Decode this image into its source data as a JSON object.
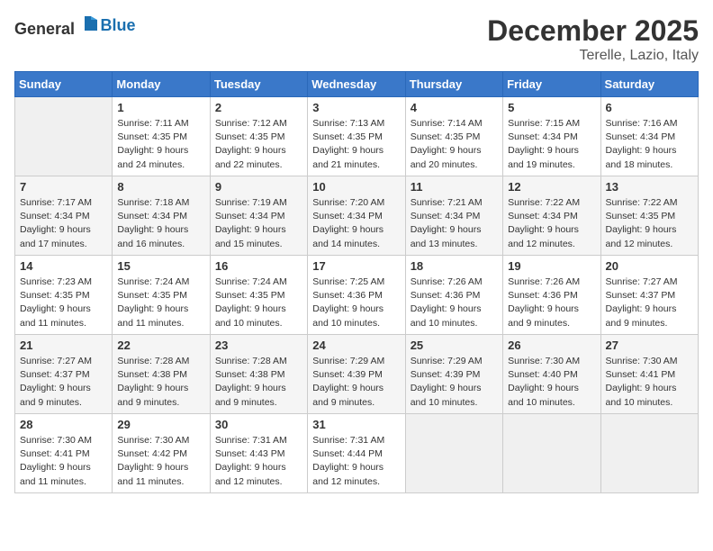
{
  "logo": {
    "general": "General",
    "blue": "Blue"
  },
  "header": {
    "month": "December 2025",
    "location": "Terelle, Lazio, Italy"
  },
  "weekdays": [
    "Sunday",
    "Monday",
    "Tuesday",
    "Wednesday",
    "Thursday",
    "Friday",
    "Saturday"
  ],
  "weeks": [
    [
      {
        "day": "",
        "sunrise": "",
        "sunset": "",
        "daylight": ""
      },
      {
        "day": "1",
        "sunrise": "Sunrise: 7:11 AM",
        "sunset": "Sunset: 4:35 PM",
        "daylight": "Daylight: 9 hours and 24 minutes."
      },
      {
        "day": "2",
        "sunrise": "Sunrise: 7:12 AM",
        "sunset": "Sunset: 4:35 PM",
        "daylight": "Daylight: 9 hours and 22 minutes."
      },
      {
        "day": "3",
        "sunrise": "Sunrise: 7:13 AM",
        "sunset": "Sunset: 4:35 PM",
        "daylight": "Daylight: 9 hours and 21 minutes."
      },
      {
        "day": "4",
        "sunrise": "Sunrise: 7:14 AM",
        "sunset": "Sunset: 4:35 PM",
        "daylight": "Daylight: 9 hours and 20 minutes."
      },
      {
        "day": "5",
        "sunrise": "Sunrise: 7:15 AM",
        "sunset": "Sunset: 4:34 PM",
        "daylight": "Daylight: 9 hours and 19 minutes."
      },
      {
        "day": "6",
        "sunrise": "Sunrise: 7:16 AM",
        "sunset": "Sunset: 4:34 PM",
        "daylight": "Daylight: 9 hours and 18 minutes."
      }
    ],
    [
      {
        "day": "7",
        "sunrise": "Sunrise: 7:17 AM",
        "sunset": "Sunset: 4:34 PM",
        "daylight": "Daylight: 9 hours and 17 minutes."
      },
      {
        "day": "8",
        "sunrise": "Sunrise: 7:18 AM",
        "sunset": "Sunset: 4:34 PM",
        "daylight": "Daylight: 9 hours and 16 minutes."
      },
      {
        "day": "9",
        "sunrise": "Sunrise: 7:19 AM",
        "sunset": "Sunset: 4:34 PM",
        "daylight": "Daylight: 9 hours and 15 minutes."
      },
      {
        "day": "10",
        "sunrise": "Sunrise: 7:20 AM",
        "sunset": "Sunset: 4:34 PM",
        "daylight": "Daylight: 9 hours and 14 minutes."
      },
      {
        "day": "11",
        "sunrise": "Sunrise: 7:21 AM",
        "sunset": "Sunset: 4:34 PM",
        "daylight": "Daylight: 9 hours and 13 minutes."
      },
      {
        "day": "12",
        "sunrise": "Sunrise: 7:22 AM",
        "sunset": "Sunset: 4:34 PM",
        "daylight": "Daylight: 9 hours and 12 minutes."
      },
      {
        "day": "13",
        "sunrise": "Sunrise: 7:22 AM",
        "sunset": "Sunset: 4:35 PM",
        "daylight": "Daylight: 9 hours and 12 minutes."
      }
    ],
    [
      {
        "day": "14",
        "sunrise": "Sunrise: 7:23 AM",
        "sunset": "Sunset: 4:35 PM",
        "daylight": "Daylight: 9 hours and 11 minutes."
      },
      {
        "day": "15",
        "sunrise": "Sunrise: 7:24 AM",
        "sunset": "Sunset: 4:35 PM",
        "daylight": "Daylight: 9 hours and 11 minutes."
      },
      {
        "day": "16",
        "sunrise": "Sunrise: 7:24 AM",
        "sunset": "Sunset: 4:35 PM",
        "daylight": "Daylight: 9 hours and 10 minutes."
      },
      {
        "day": "17",
        "sunrise": "Sunrise: 7:25 AM",
        "sunset": "Sunset: 4:36 PM",
        "daylight": "Daylight: 9 hours and 10 minutes."
      },
      {
        "day": "18",
        "sunrise": "Sunrise: 7:26 AM",
        "sunset": "Sunset: 4:36 PM",
        "daylight": "Daylight: 9 hours and 10 minutes."
      },
      {
        "day": "19",
        "sunrise": "Sunrise: 7:26 AM",
        "sunset": "Sunset: 4:36 PM",
        "daylight": "Daylight: 9 hours and 9 minutes."
      },
      {
        "day": "20",
        "sunrise": "Sunrise: 7:27 AM",
        "sunset": "Sunset: 4:37 PM",
        "daylight": "Daylight: 9 hours and 9 minutes."
      }
    ],
    [
      {
        "day": "21",
        "sunrise": "Sunrise: 7:27 AM",
        "sunset": "Sunset: 4:37 PM",
        "daylight": "Daylight: 9 hours and 9 minutes."
      },
      {
        "day": "22",
        "sunrise": "Sunrise: 7:28 AM",
        "sunset": "Sunset: 4:38 PM",
        "daylight": "Daylight: 9 hours and 9 minutes."
      },
      {
        "day": "23",
        "sunrise": "Sunrise: 7:28 AM",
        "sunset": "Sunset: 4:38 PM",
        "daylight": "Daylight: 9 hours and 9 minutes."
      },
      {
        "day": "24",
        "sunrise": "Sunrise: 7:29 AM",
        "sunset": "Sunset: 4:39 PM",
        "daylight": "Daylight: 9 hours and 9 minutes."
      },
      {
        "day": "25",
        "sunrise": "Sunrise: 7:29 AM",
        "sunset": "Sunset: 4:39 PM",
        "daylight": "Daylight: 9 hours and 10 minutes."
      },
      {
        "day": "26",
        "sunrise": "Sunrise: 7:30 AM",
        "sunset": "Sunset: 4:40 PM",
        "daylight": "Daylight: 9 hours and 10 minutes."
      },
      {
        "day": "27",
        "sunrise": "Sunrise: 7:30 AM",
        "sunset": "Sunset: 4:41 PM",
        "daylight": "Daylight: 9 hours and 10 minutes."
      }
    ],
    [
      {
        "day": "28",
        "sunrise": "Sunrise: 7:30 AM",
        "sunset": "Sunset: 4:41 PM",
        "daylight": "Daylight: 9 hours and 11 minutes."
      },
      {
        "day": "29",
        "sunrise": "Sunrise: 7:30 AM",
        "sunset": "Sunset: 4:42 PM",
        "daylight": "Daylight: 9 hours and 11 minutes."
      },
      {
        "day": "30",
        "sunrise": "Sunrise: 7:31 AM",
        "sunset": "Sunset: 4:43 PM",
        "daylight": "Daylight: 9 hours and 12 minutes."
      },
      {
        "day": "31",
        "sunrise": "Sunrise: 7:31 AM",
        "sunset": "Sunset: 4:44 PM",
        "daylight": "Daylight: 9 hours and 12 minutes."
      },
      {
        "day": "",
        "sunrise": "",
        "sunset": "",
        "daylight": ""
      },
      {
        "day": "",
        "sunrise": "",
        "sunset": "",
        "daylight": ""
      },
      {
        "day": "",
        "sunrise": "",
        "sunset": "",
        "daylight": ""
      }
    ]
  ]
}
